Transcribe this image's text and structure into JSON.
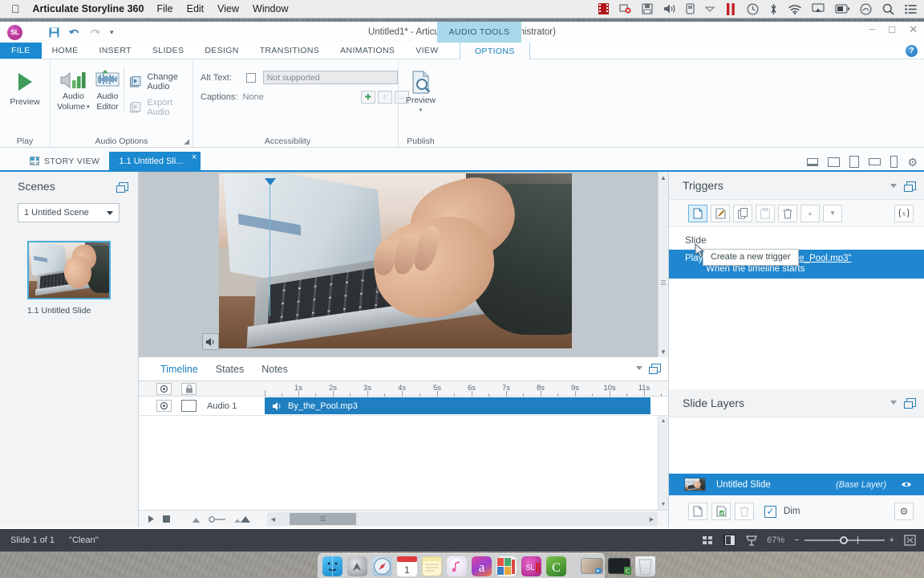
{
  "macbar": {
    "apple_icon": "apple-logo-icon",
    "app_name": "Articulate Storyline 360",
    "menus": [
      "File",
      "Edit",
      "View",
      "Window"
    ],
    "status_icons": [
      "film-strip-icon",
      "screen-record-icon",
      "save-disk-icon",
      "volume-icon",
      "sim-card-icon",
      "chevron-down-icon",
      "pause-icon",
      "time-machine-icon",
      "bluetooth-icon",
      "wifi-icon",
      "airplay-icon",
      "battery-icon",
      "siri-icon",
      "spotlight-search-icon",
      "notification-center-icon"
    ]
  },
  "window": {
    "logo_text": "SL",
    "title": "Untitled1* - Articulate Storyline (Administrator)",
    "contextual_tab": "AUDIO TOOLS",
    "quick_access": [
      "save-icon",
      "undo-icon",
      "redo-icon",
      "customize-qat-icon"
    ],
    "controls": [
      "minimize-icon",
      "maximize-icon",
      "close-icon"
    ],
    "help_label": "?"
  },
  "ribbon": {
    "tabs": [
      "FILE",
      "HOME",
      "INSERT",
      "SLIDES",
      "DESIGN",
      "TRANSITIONS",
      "ANIMATIONS",
      "VIEW",
      "HELP"
    ],
    "active_tab": "OPTIONS",
    "groups": {
      "play": {
        "label": "Play",
        "preview_label": "Preview"
      },
      "audio_options": {
        "label": "Audio Options",
        "audio_volume_label": "Audio\nVolume",
        "audio_volume_line1": "Audio",
        "audio_volume_line2": "Volume",
        "audio_editor_line1": "Audio",
        "audio_editor_line2": "Editor",
        "change_audio_label": "Change Audio",
        "export_audio_label": "Export Audio"
      },
      "accessibility": {
        "label": "Accessibility",
        "alt_text_label": "Alt Text:",
        "alt_text_value": "Not supported",
        "captions_label": "Captions:",
        "captions_value": "None",
        "caption_buttons": [
          "add-caption-icon",
          "import-caption-icon",
          "export-caption-icon"
        ]
      },
      "publish": {
        "label": "Publish",
        "preview_label": "Preview"
      }
    }
  },
  "viewbar": {
    "story_view_label": "STORY VIEW",
    "active_tab_label": "1.1 Untitled Sli...",
    "close_glyph": "×",
    "device_icons": [
      "preview-desktop-icon",
      "preview-tablet-landscape-icon",
      "preview-tablet-portrait-icon",
      "preview-phone-landscape-icon",
      "preview-phone-portrait-icon",
      "player-settings-gear-icon"
    ]
  },
  "scenes": {
    "title": "Scenes",
    "scene_selected": "1 Untitled Scene",
    "slide_caption": "1.1 Untitled Slide"
  },
  "timeline": {
    "tabs": [
      "Timeline",
      "States",
      "Notes"
    ],
    "active_tab": "Timeline",
    "ruler_labels": [
      "1s",
      "2s",
      "3s",
      "4s",
      "5s",
      "6s",
      "7s",
      "8s",
      "9s",
      "10s",
      "11s"
    ],
    "playhead_time": "0s",
    "tracks": [
      {
        "name": "Audio 1",
        "clip_label": "By_the_Pool.mp3",
        "icon": "speaker-icon"
      }
    ],
    "footer_icons": [
      "play-icon",
      "stop-icon",
      "zoom-out-timeline-icon",
      "timeline-scale-icon",
      "zoom-in-timeline-icon"
    ]
  },
  "triggers": {
    "title": "Triggers",
    "toolbar_icons": [
      "new-trigger-icon",
      "edit-trigger-icon",
      "copy-trigger-icon",
      "paste-trigger-icon",
      "delete-trigger-icon",
      "move-up-icon",
      "move-down-icon"
    ],
    "variables_button_label": "(x)",
    "tooltip": "Create a new trigger",
    "section_label": "Slide",
    "items": [
      {
        "action": "Play media",
        "target": "Audio 1 - \"By_the_Pool.mp3\"",
        "condition": "When the timeline starts"
      }
    ]
  },
  "slide_layers": {
    "title": "Slide Layers",
    "rows": [
      {
        "name": "Untitled Slide",
        "badge": "(Base Layer)",
        "eye_icon": "visibility-eye-icon"
      }
    ],
    "footer": {
      "buttons": [
        "new-layer-icon",
        "duplicate-layer-icon",
        "delete-layer-icon"
      ],
      "dim_label": "Dim",
      "dim_checked": true,
      "settings_icon": "layer-properties-gear-icon"
    }
  },
  "statusbar": {
    "slide_count": "Slide 1 of 1",
    "theme_name": "\"Clean\"",
    "view_icons": [
      "grid-view-icon",
      "normal-view-icon",
      "form-view-icon"
    ],
    "zoom_label": "67%",
    "zoom_out_glyph": "−",
    "zoom_in_glyph": "+",
    "fit_icon": "fit-to-window-icon"
  },
  "dock": {
    "apps": [
      "Finder",
      "Launchpad",
      "Safari",
      "Calendar",
      "Notes",
      "iTunes",
      "Articulate",
      "Microsoft Office",
      "Storyline",
      "Camtasia"
    ],
    "minimized": [
      "Preview Window",
      "Terminal Window"
    ],
    "trash": "Trash"
  },
  "colors": {
    "accent_blue": "#1f87d0",
    "ribbon_blue": "#1b8ad0",
    "contextual_tab": "#a8d8ea",
    "status_dark": "#3a3f48",
    "panel_grey": "#f1f3f5"
  }
}
